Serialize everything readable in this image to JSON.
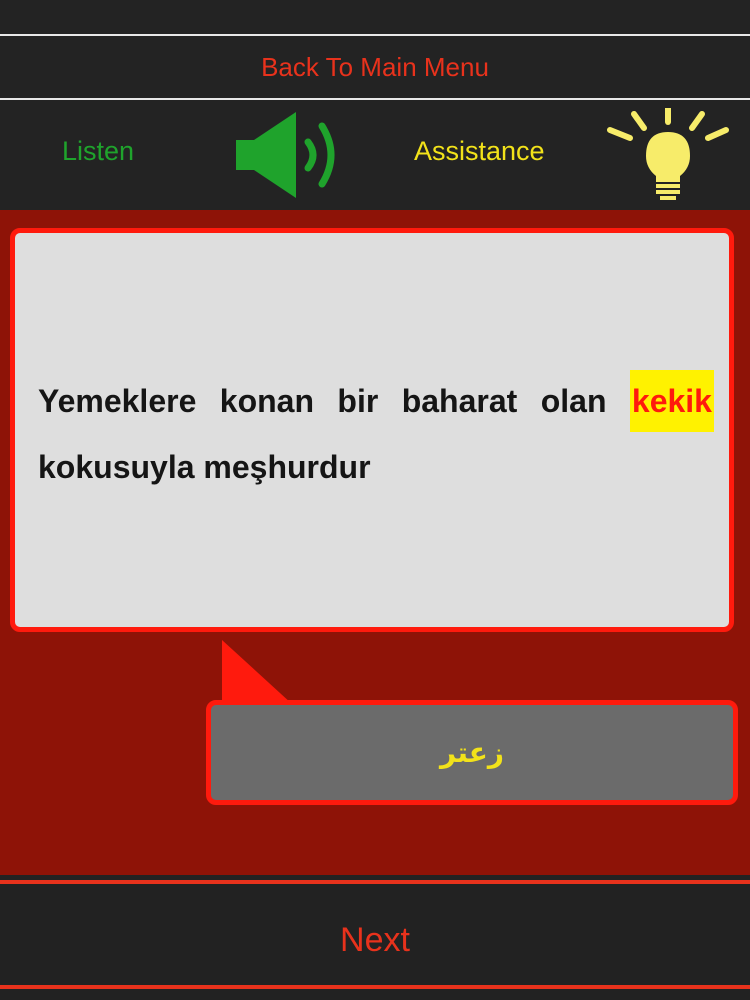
{
  "header": {
    "back_label": "Back To Main Menu",
    "listen_label": "Listen",
    "assistance_label": "Assistance"
  },
  "question": {
    "words_line1": [
      "Yemeklere",
      "konan",
      "bir",
      "baharat",
      "olan"
    ],
    "highlight_word": "kekik",
    "line2": "kokusuyla meşhurdur"
  },
  "answer": {
    "text": "زعتر"
  },
  "footer": {
    "next_label": "Next"
  },
  "icons": {
    "listen": "speaker-icon",
    "assistance": "lightbulb-icon"
  },
  "colors": {
    "accent_red": "#e8321c",
    "listen_green": "#1fa32c",
    "assist_yellow": "#f2e21a",
    "panel_red": "#8e1307",
    "border_red": "#ff1a0d",
    "highlight_yellow": "#fff200"
  }
}
